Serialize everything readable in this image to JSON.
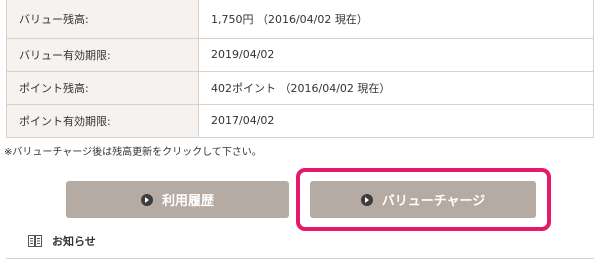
{
  "table": {
    "rows": [
      {
        "label": "バリュー残高:",
        "value": "1,750円 （2016/04/02 現在）"
      },
      {
        "label": "バリュー有効期限:",
        "value": "2019/04/02"
      },
      {
        "label": "ポイント残高:",
        "value": "402ポイント （2016/04/02 現在）"
      },
      {
        "label": "ポイント有効期限:",
        "value": "2017/04/02"
      }
    ]
  },
  "note": "※バリューチャージ後は残高更新をクリックして下さい。",
  "buttons": {
    "history": "利用履歴",
    "charge": "バリューチャージ"
  },
  "notice": {
    "label": "お知らせ",
    "icon": "book-icon"
  },
  "colors": {
    "button": "#b5aba3",
    "highlight": "#e5196b",
    "border": "#d7d1cb"
  }
}
